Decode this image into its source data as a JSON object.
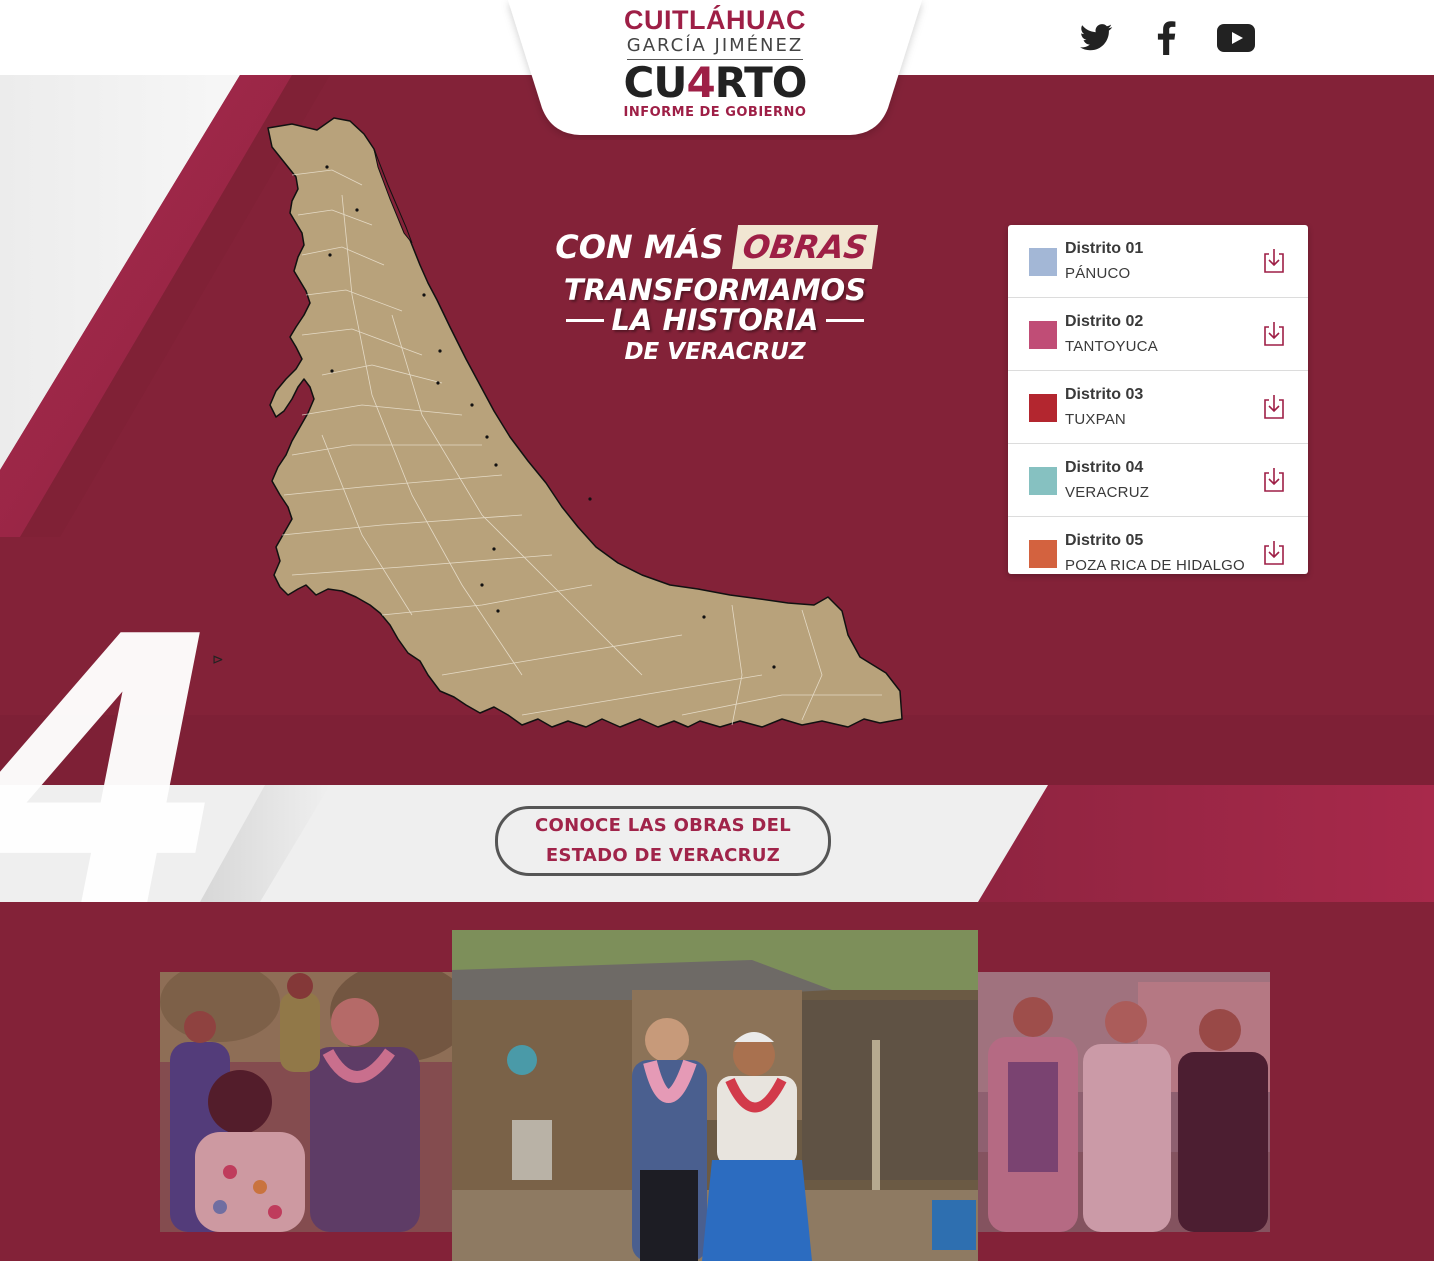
{
  "header": {
    "logo": {
      "line1": "CUITLÁHUAC",
      "line2": "GARCÍA JIMÉNEZ",
      "line3_a": "CU",
      "line3_b": "4",
      "line3_c": "RTO",
      "line4": "INFORME DE GOBIERNO"
    },
    "social": [
      {
        "icon": "twitter-icon"
      },
      {
        "icon": "facebook-icon"
      },
      {
        "icon": "youtube-icon"
      }
    ]
  },
  "hero": {
    "headline": {
      "part1": "CON MÁS",
      "highlight": "OBRAS",
      "line2": "TRANSFORMAMOS",
      "line3": "LA HISTORIA",
      "line4": "DE VERACRUZ"
    },
    "big_number": "4",
    "map_region": "Veracruz",
    "map_fill": "#b8a27b"
  },
  "districts": [
    {
      "name": "Distrito 01",
      "city": "PÁNUCO",
      "color": "#a3b7d6"
    },
    {
      "name": "Distrito 02",
      "city": "TANTOYUCA",
      "color": "#c04d76"
    },
    {
      "name": "Distrito 03",
      "city": "TUXPAN",
      "color": "#b3262f"
    },
    {
      "name": "Distrito 04",
      "city": "VERACRUZ",
      "color": "#86c1c1"
    },
    {
      "name": "Distrito 05",
      "city": "POZA RICA DE HIDALGO",
      "color": "#d3623f"
    }
  ],
  "cta": {
    "label": "CONOCE LAS OBRAS DEL\nESTADO DE VERACRUZ"
  },
  "colors": {
    "brand": "#832238",
    "accent": "#9e1f46",
    "band": "#ededed"
  }
}
